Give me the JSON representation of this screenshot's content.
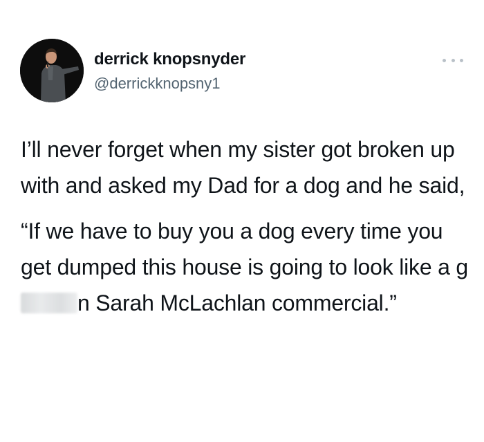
{
  "author": {
    "name": "derrick knopsnyder",
    "handle": "@derrickknopsny1",
    "avatar_icon": "person-on-stage-photo"
  },
  "menu": {
    "icon": "more-horizontal-icon"
  },
  "tweet": {
    "paragraph_1": "I’ll never forget when my sister got broken up with and asked my Dad for a dog and he said,",
    "paragraph_2_before": "“If we have to buy you a dog every time you get dumped this house is going to look like a g",
    "paragraph_2_after": "n Sarah McLachlan commercial.”"
  },
  "colors": {
    "text": "#0f1419",
    "secondary": "#536471",
    "dots": "#b9c1c8"
  }
}
